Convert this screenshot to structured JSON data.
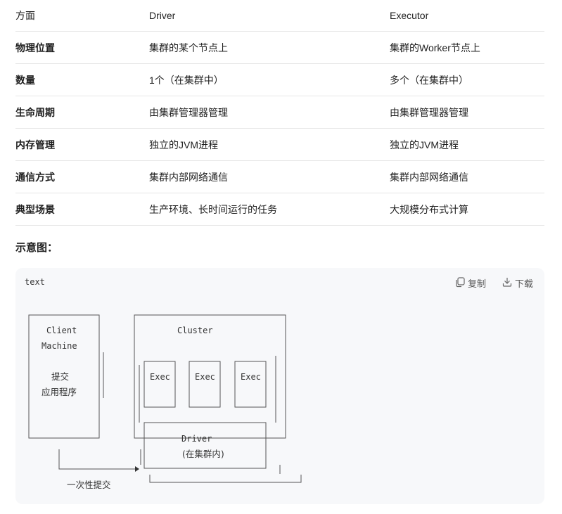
{
  "table": {
    "headers": [
      "方面",
      "Driver",
      "Executor"
    ],
    "rows": [
      [
        "物理位置",
        "集群的某个节点上",
        "集群的Worker节点上"
      ],
      [
        "数量",
        "1个（在集群中）",
        "多个（在集群中）"
      ],
      [
        "生命周期",
        "由集群管理器管理",
        "由集群管理器管理"
      ],
      [
        "内存管理",
        "独立的JVM进程",
        "独立的JVM进程"
      ],
      [
        "通信方式",
        "集群内部网络通信",
        "集群内部网络通信"
      ],
      [
        "典型场景",
        "生产环境、长时间运行的任务",
        "大规模分布式计算"
      ]
    ]
  },
  "section": {
    "title": "示意图："
  },
  "code": {
    "lang": "text",
    "copy_label": "复制",
    "download_label": "下载",
    "icons": {
      "copy": "copy-icon",
      "download": "download-icon"
    },
    "diagram": {
      "client_line1": "Client",
      "client_line2": "Machine",
      "submit": "提交",
      "app": "应用程序",
      "cluster": "Cluster",
      "exec1": "Exec",
      "exec2": "Exec",
      "exec3": "Exec",
      "driver": "Driver",
      "driver_note": "(在集群内)",
      "arrow_label": "一次性提交"
    }
  }
}
